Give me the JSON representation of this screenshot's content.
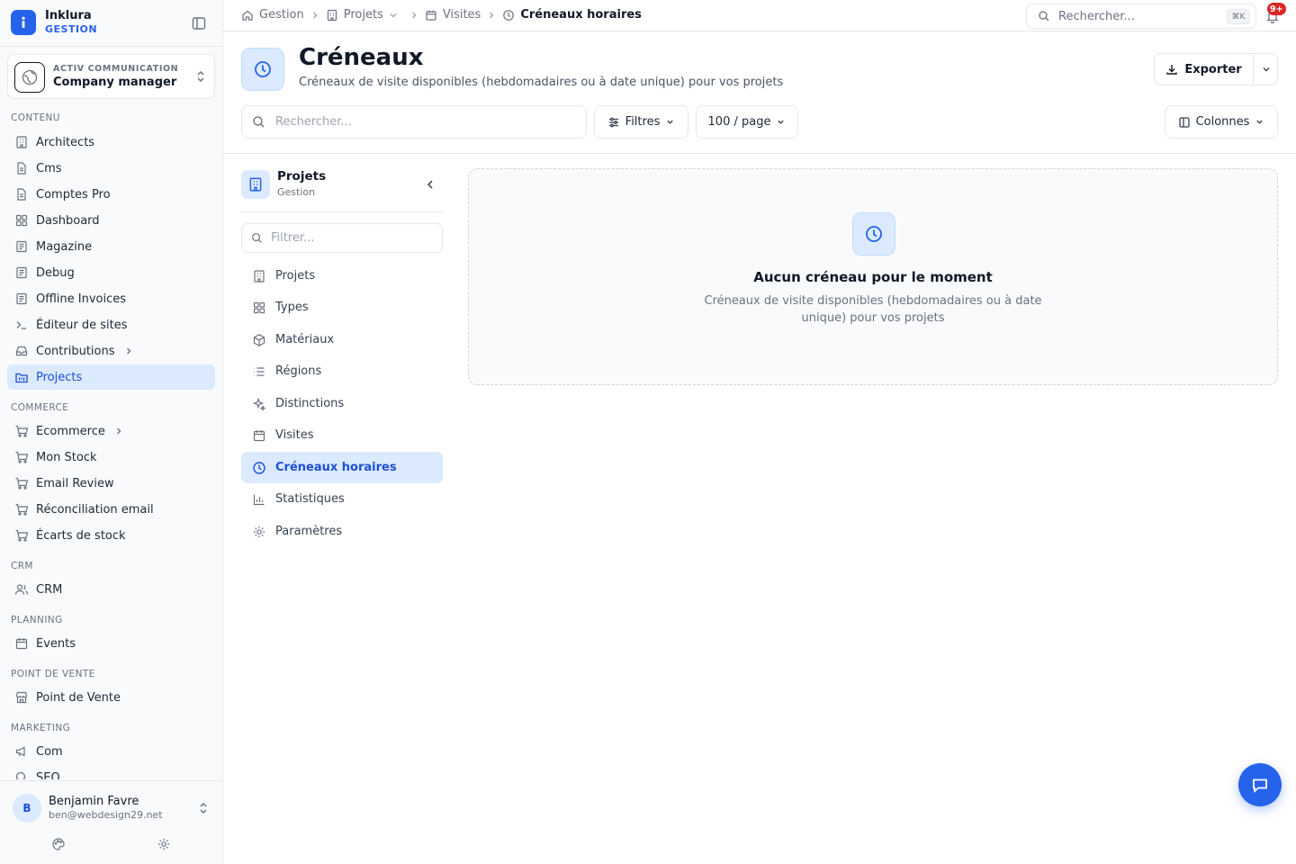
{
  "brand": {
    "name": "Inklura",
    "subtitle": "GESTION"
  },
  "company": {
    "org": "ACTIV COMMUNICATION",
    "role": "Company manager"
  },
  "sidebar": {
    "sections": {
      "contenu": "CONTENU",
      "commerce": "COMMERCE",
      "crm": "CRM",
      "planning": "PLANNING",
      "pos": "POINT DE VENTE",
      "marketing": "MARKETING"
    },
    "items": [
      {
        "label": "Architects",
        "icon": "building-icon"
      },
      {
        "label": "Cms",
        "icon": "file-icon"
      },
      {
        "label": "Comptes Pro",
        "icon": "file-icon"
      },
      {
        "label": "Dashboard",
        "icon": "grid-icon"
      },
      {
        "label": "Magazine",
        "icon": "newspaper-icon"
      },
      {
        "label": "Debug",
        "icon": "newspaper-icon"
      },
      {
        "label": "Offline Invoices",
        "icon": "newspaper-icon"
      },
      {
        "label": "Éditeur de sites",
        "icon": "terminal-icon"
      },
      {
        "label": "Contributions",
        "icon": "inbox-icon"
      },
      {
        "label": "Projects",
        "icon": "folder-kanban-icon",
        "active": true
      },
      {
        "label": "Ecommerce",
        "icon": "cart-icon"
      },
      {
        "label": "Mon Stock",
        "icon": "cart-icon"
      },
      {
        "label": "Email Review",
        "icon": "cart-icon"
      },
      {
        "label": "Réconciliation email",
        "icon": "cart-icon"
      },
      {
        "label": "Écarts de stock",
        "icon": "cart-icon"
      },
      {
        "label": "CRM",
        "icon": "users-icon"
      },
      {
        "label": "Events",
        "icon": "calendar-icon"
      },
      {
        "label": "Point de Vente",
        "icon": "store-icon"
      },
      {
        "label": "Com",
        "icon": "megaphone-icon"
      },
      {
        "label": "SEO",
        "icon": "search-icon"
      }
    ]
  },
  "user": {
    "initial": "B",
    "name": "Benjamin Favre",
    "email": "ben@webdesign29.net"
  },
  "breadcrumb": {
    "items": [
      {
        "label": "Gestion",
        "icon": "home-icon"
      },
      {
        "label": "Projets",
        "icon": "building-icon"
      },
      {
        "label": "Visites",
        "icon": "calendar-icon"
      },
      {
        "label": "Créneaux horaires",
        "icon": "clock-icon"
      }
    ]
  },
  "topbar": {
    "search_placeholder": "Rechercher...",
    "shortcut": "⌘K",
    "notifications_badge": "9+"
  },
  "header": {
    "title": "Créneaux",
    "description": "Créneaux de visite disponibles (hebdomadaires ou à date unique) pour vos projets",
    "export_label": "Exporter"
  },
  "toolbar": {
    "search_placeholder": "Rechercher...",
    "filters_label": "Filtres",
    "page_size_label": "100 / page",
    "columns_label": "Colonnes"
  },
  "panel": {
    "title": "Projets",
    "subtitle": "Gestion",
    "filter_placeholder": "Filtrer...",
    "items": [
      {
        "label": "Projets",
        "icon": "building-icon"
      },
      {
        "label": "Types",
        "icon": "grid-icon"
      },
      {
        "label": "Matériaux",
        "icon": "box-icon"
      },
      {
        "label": "Régions",
        "icon": "list-icon"
      },
      {
        "label": "Distinctions",
        "icon": "sparkles-icon"
      },
      {
        "label": "Visites",
        "icon": "calendar-icon"
      },
      {
        "label": "Créneaux horaires",
        "icon": "clock-icon",
        "active": true
      },
      {
        "label": "Statistiques",
        "icon": "bar-chart-icon"
      },
      {
        "label": "Paramètres",
        "icon": "gear-icon"
      }
    ]
  },
  "empty_state": {
    "title": "Aucun créneau pour le moment",
    "description": "Créneaux de visite disponibles (hebdomadaires ou à date unique) pour vos projets"
  },
  "colors": {
    "accent": "#2563eb",
    "accent_bg": "#dbeafe",
    "badge": "#dc2626"
  }
}
